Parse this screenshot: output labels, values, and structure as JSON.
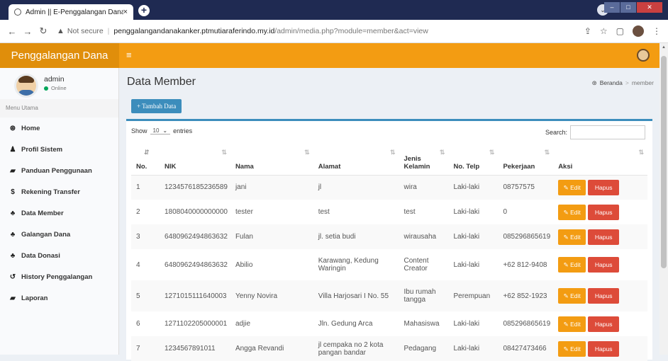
{
  "browser": {
    "tab_title": "Admin || E-Penggalangan Dana",
    "tab_close": "×",
    "new_tab": "+",
    "not_secure": "Not secure",
    "url_host": "penggalangandanakanker.ptmutiaraferindo.my.id",
    "url_path": "/admin/media.php?module=member&act=view"
  },
  "header": {
    "brand": "Penggalangan Dana",
    "menu_toggle": "≡"
  },
  "user": {
    "name": "admin",
    "status": "Online"
  },
  "sidebar": {
    "heading": "Menu Utama",
    "items": [
      {
        "label": "Home",
        "icon": "dashboard-icon",
        "glyph": "⊛"
      },
      {
        "label": "Profil Sistem",
        "icon": "user-icon",
        "glyph": "♟"
      },
      {
        "label": "Panduan Penggunaan",
        "icon": "book-icon",
        "glyph": "▰"
      },
      {
        "label": "Rekening Transfer",
        "icon": "dollar-icon",
        "glyph": "$"
      },
      {
        "label": "Data Member",
        "icon": "users-icon",
        "glyph": "♣"
      },
      {
        "label": "Galangan Dana",
        "icon": "users-icon",
        "glyph": "♣"
      },
      {
        "label": "Data Donasi",
        "icon": "users-icon",
        "glyph": "♣"
      },
      {
        "label": "History Penggalangan",
        "icon": "history-icon",
        "glyph": "↺"
      },
      {
        "label": "Laporan",
        "icon": "book-icon",
        "glyph": "▰"
      }
    ]
  },
  "page": {
    "title": "Data Member",
    "breadcrumb": {
      "home": "Beranda",
      "separator": ">",
      "current": "member"
    },
    "add_button": "Tambah Data"
  },
  "table_controls": {
    "show": "Show",
    "entries_value": "10",
    "entries": "entries",
    "search": "Search:"
  },
  "table": {
    "headers": [
      "No.",
      "NIK",
      "Nama",
      "Alamat",
      "Jenis Kelamin",
      "No. Telp",
      "Pekerjaan",
      "Aksi"
    ],
    "edit_label": "Edit",
    "delete_label": "Hapus",
    "rows": [
      [
        "1",
        "1234576185236589",
        "jani",
        "jl",
        "wira",
        "Laki-laki",
        "08757575"
      ],
      [
        "2",
        "1808040000000000",
        "tester",
        "test",
        "test",
        "Laki-laki",
        "0"
      ],
      [
        "3",
        "6480962494863632",
        "Fulan",
        "jl. setia budi",
        "wirausaha",
        "Laki-laki",
        "085296865619"
      ],
      [
        "4",
        "6480962494863632",
        "Abilio",
        "Karawang, Kedung Waringin",
        "Content Creator",
        "Laki-laki",
        "+62 812-9408"
      ],
      [
        "5",
        "1271015111640003",
        "Yenny Novira",
        "Villa Harjosari I No. 55",
        "Ibu rumah tangga",
        "Perempuan",
        "+62 852-1923"
      ],
      [
        "6",
        "1271102205000001",
        "adjie",
        "Jln. Gedung Arca",
        "Mahasiswa",
        "Laki-laki",
        "085296865619"
      ],
      [
        "7",
        "1234567891011",
        "Angga Revandi",
        "jl cempaka no 2 kota pangan bandar",
        "Pedagang",
        "Laki-laki",
        "08427473466"
      ]
    ]
  }
}
